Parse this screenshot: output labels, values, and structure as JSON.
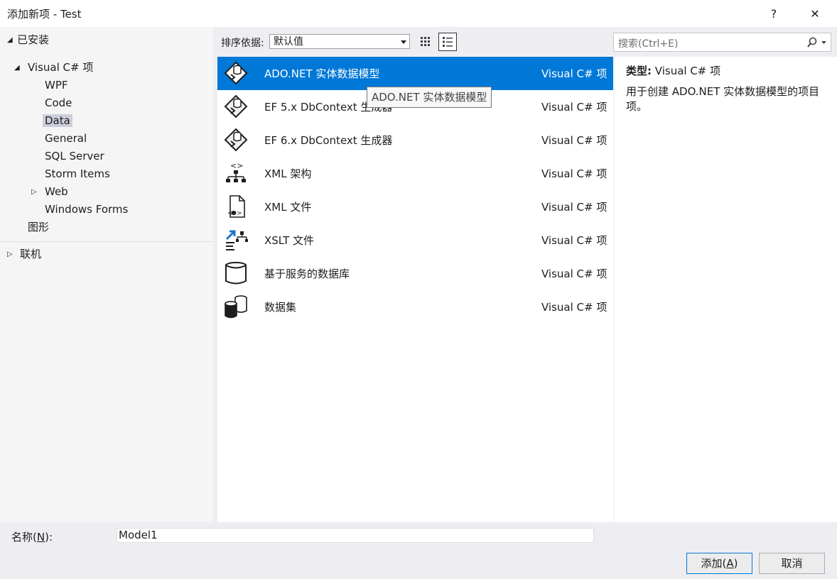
{
  "window": {
    "title": "添加新项 - Test",
    "help_glyph": "?",
    "close_glyph": "✕"
  },
  "tree": {
    "installed": "已安装",
    "visual_csharp": "Visual C# 项",
    "children": [
      "WPF",
      "Code",
      "Data",
      "General",
      "SQL Server",
      "Storm Items",
      "Web",
      "Windows Forms"
    ],
    "graphics": "图形",
    "online": "联机",
    "selected": "Data"
  },
  "toolbar": {
    "sort_label": "排序依据:",
    "sort_value": "默认值",
    "search_placeholder": "搜索(Ctrl+E)"
  },
  "items": [
    {
      "name": "ADO.NET 实体数据模型",
      "lang": "Visual C# 项",
      "icon": "entity-model-icon",
      "selected": true
    },
    {
      "name": "EF 5.x DbContext 生成器",
      "lang": "Visual C# 项",
      "icon": "entity-model-icon"
    },
    {
      "name": "EF 6.x DbContext 生成器",
      "lang": "Visual C# 项",
      "icon": "entity-model-icon"
    },
    {
      "name": "XML 架构",
      "lang": "Visual C# 项",
      "icon": "xml-schema-icon"
    },
    {
      "name": "XML 文件",
      "lang": "Visual C# 项",
      "icon": "xml-file-icon"
    },
    {
      "name": "XSLT 文件",
      "lang": "Visual C# 项",
      "icon": "xslt-file-icon"
    },
    {
      "name": "基于服务的数据库",
      "lang": "Visual C# 项",
      "icon": "database-icon"
    },
    {
      "name": "数据集",
      "lang": "Visual C# 项",
      "icon": "dataset-icon"
    }
  ],
  "tooltip": "ADO.NET 实体数据模型",
  "details": {
    "type_label": "类型:",
    "type_value": "Visual C# 项",
    "description": "用于创建 ADO.NET 实体数据模型的项目项。"
  },
  "footer": {
    "name_label_pre": "名称(",
    "name_label_key": "N",
    "name_label_post": "):",
    "name_value": "Model1",
    "add_pre": "添加(",
    "add_key": "A",
    "add_post": ")",
    "cancel": "取消"
  },
  "colors": {
    "selection": "#0078d7",
    "tree_selection": "#cccedb",
    "dialog_bg": "#eeeef2"
  }
}
